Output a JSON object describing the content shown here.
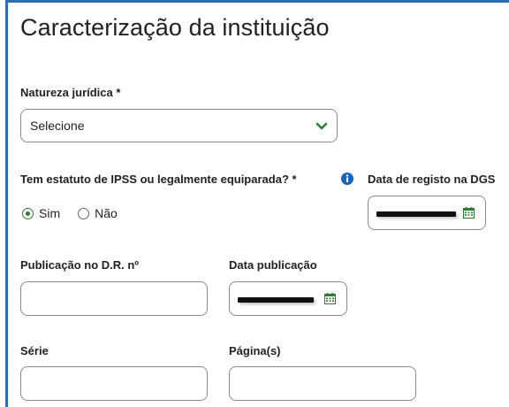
{
  "page_title": "Caracterização da instituição",
  "natureza_juridica": {
    "label": "Natureza jurídica *",
    "selected": "Selecione",
    "icon": "chevron-down-icon"
  },
  "ipss": {
    "label": "Tem estatuto de IPSS ou legalmente equiparada? *",
    "info_icon": "info-icon",
    "options": [
      "Sim",
      "Não"
    ],
    "selected": "Sim"
  },
  "data_registo": {
    "label": "Data de registo na DGS",
    "icon": "calendar-icon"
  },
  "publicacao": {
    "label": "Publicação no D.R. nº",
    "value": ""
  },
  "data_publicacao": {
    "label": "Data publicação",
    "icon": "calendar-icon"
  },
  "serie": {
    "label": "Série",
    "value": ""
  },
  "paginas": {
    "label": "Página(s)",
    "value": ""
  },
  "colors": {
    "accent_green": "#2e7d32",
    "info_blue": "#1565c0",
    "frame_blue": "#2a6db3"
  }
}
